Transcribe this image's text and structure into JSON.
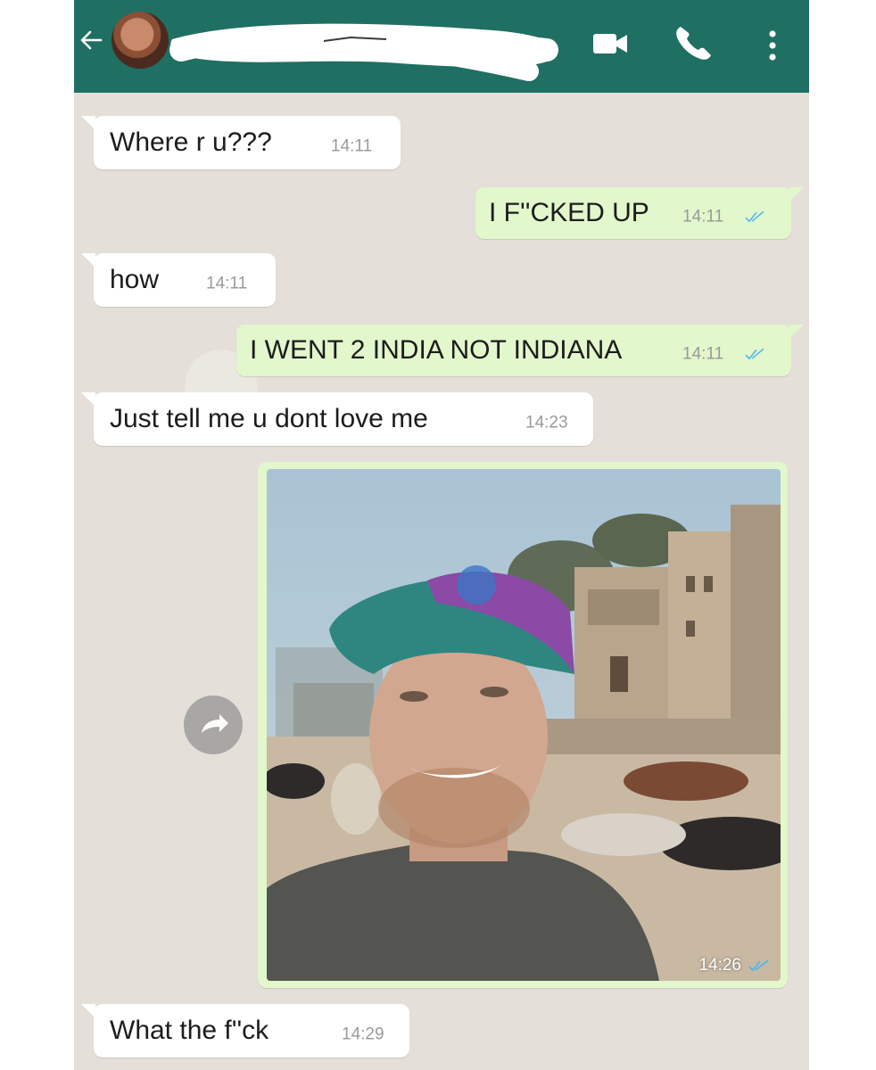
{
  "header": {
    "contact_name_redacted": true,
    "icons": [
      "back-arrow-icon",
      "avatar",
      "video-call-icon",
      "phone-icon",
      "more-vert-icon"
    ],
    "color": "#1f6f62"
  },
  "messages": [
    {
      "direction": "in",
      "text": "Where r u???",
      "time": "14:11"
    },
    {
      "direction": "out",
      "text": "I F''CKED UP",
      "time": "14:11",
      "status": "read"
    },
    {
      "direction": "in",
      "text": "how",
      "time": "14:11"
    },
    {
      "direction": "out",
      "text": "I WENT 2 INDIA NOT INDIANA",
      "time": "14:11",
      "status": "read"
    },
    {
      "direction": "in",
      "text": "Just tell me u dont love me",
      "time": "14:23"
    },
    {
      "direction": "out",
      "type": "image",
      "time": "14:26",
      "status": "read"
    },
    {
      "direction": "in",
      "text": "What the f''ck",
      "time": "14:29"
    }
  ],
  "colors": {
    "incoming_bubble": "#ffffff",
    "outgoing_bubble": "#e2f7cb",
    "read_ticks": "#4fb6ec",
    "chat_background": "#e4e0d9"
  }
}
